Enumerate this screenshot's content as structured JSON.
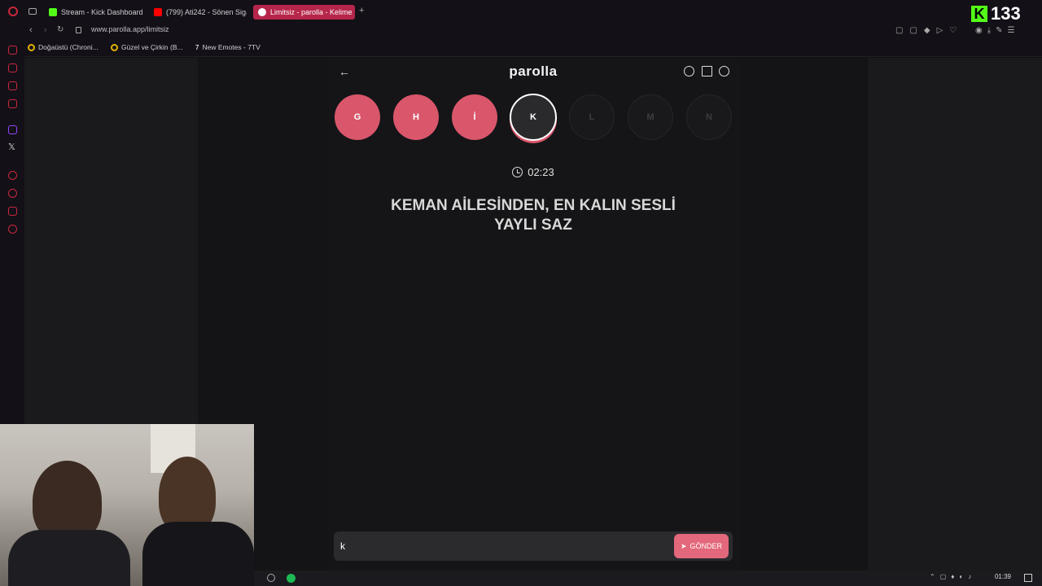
{
  "browser": {
    "tabs": [
      {
        "label": "Stream - Kick Dashboard",
        "color": "#53fc18"
      },
      {
        "label": "(799) Ati242 - Sönen Siga",
        "color": "#ff0000"
      },
      {
        "label": "Limitsiz - parolla - Kelime",
        "color": "#d9566b"
      }
    ],
    "url": "www.parolla.app/limitsiz",
    "bookmarks": [
      "Doğaüstü (Chroni...",
      "Güzel ve Çirkin (B...",
      "New Emotes - 7TV"
    ]
  },
  "kick": {
    "logo": "K",
    "count": "133"
  },
  "app": {
    "title": "parolla",
    "letters": [
      {
        "char": "G",
        "state": "done"
      },
      {
        "char": "H",
        "state": "done"
      },
      {
        "char": "İ",
        "state": "done"
      },
      {
        "char": "K",
        "state": "current"
      },
      {
        "char": "L",
        "state": "pending"
      },
      {
        "char": "M",
        "state": "pending"
      },
      {
        "char": "N",
        "state": "pending"
      }
    ],
    "timer": "02:23",
    "question_line1": "KEMAN AİLESİNDEN, EN KALIN SESLİ",
    "question_line2": "YAYLI SAZ",
    "answer_value": "k",
    "send_label": "GÖNDER"
  },
  "taskbar": {
    "time": "01:39"
  }
}
